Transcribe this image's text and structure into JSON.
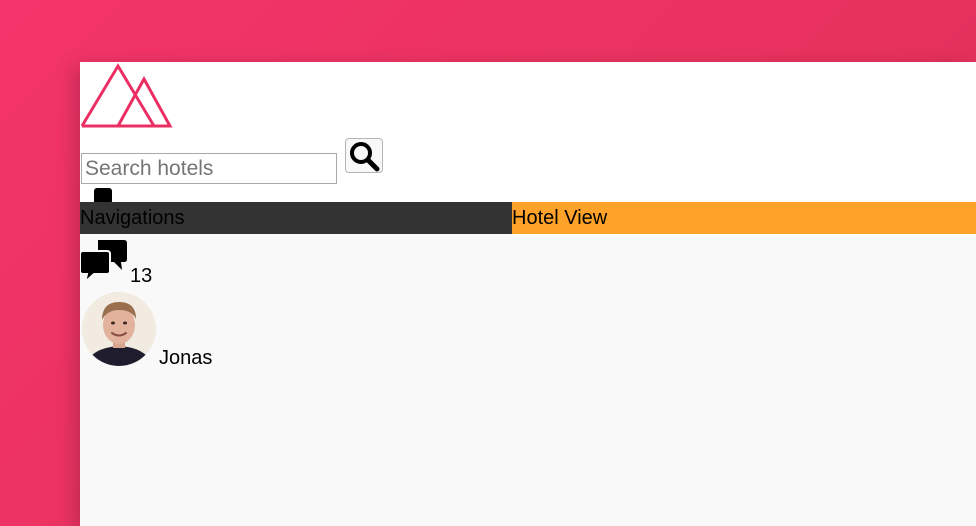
{
  "header": {
    "logo_icon": "mountain-logo",
    "search": {
      "placeholder": "Search hotels",
      "value": "",
      "button_icon": "magnifier-icon"
    }
  },
  "navigation": {
    "label": "Navigations"
  },
  "hotel_view": {
    "label": "Hotel View"
  },
  "notifications": {
    "icon": "chat-bubbles-icon",
    "count": "13"
  },
  "user": {
    "name": "Jonas",
    "avatar_icon": "user-photo"
  },
  "colors": {
    "brand": "#eb2f64",
    "nav_bg": "#333333",
    "hotel_view_bg": "#ffa22a",
    "page_bg": "#f9f9f9"
  }
}
